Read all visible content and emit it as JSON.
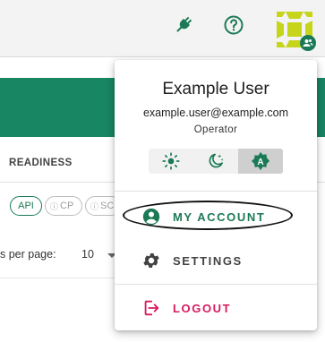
{
  "topbar": {
    "plug_icon": "power-plug-icon",
    "help_icon": "help-circle-icon",
    "avatar_icon": "identicon-avatar",
    "badge_icon": "account-group-icon"
  },
  "background": {
    "column_header": "READINESS",
    "chips": [
      {
        "label": "API",
        "icon": ""
      },
      {
        "label": "CP",
        "icon": "?"
      },
      {
        "label": "SC",
        "icon": "?"
      }
    ],
    "rows_per_page_label": "s per page:",
    "rows_per_page_value": "10"
  },
  "menu": {
    "user_name": "Example User",
    "email": "example.user@example.com",
    "role": "Operator",
    "theme_options": [
      "light",
      "dark",
      "auto"
    ],
    "theme_selected": "auto",
    "items": [
      {
        "label": "MY ACCOUNT",
        "icon": "account-circle-icon"
      },
      {
        "label": "SETTINGS",
        "icon": "gear-icon"
      },
      {
        "label": "LOGOUT",
        "icon": "logout-icon"
      }
    ]
  },
  "colors": {
    "primary": "#1b7a55",
    "banner": "#188563",
    "logout": "#d81b60",
    "avatar": "#c6d41a"
  }
}
